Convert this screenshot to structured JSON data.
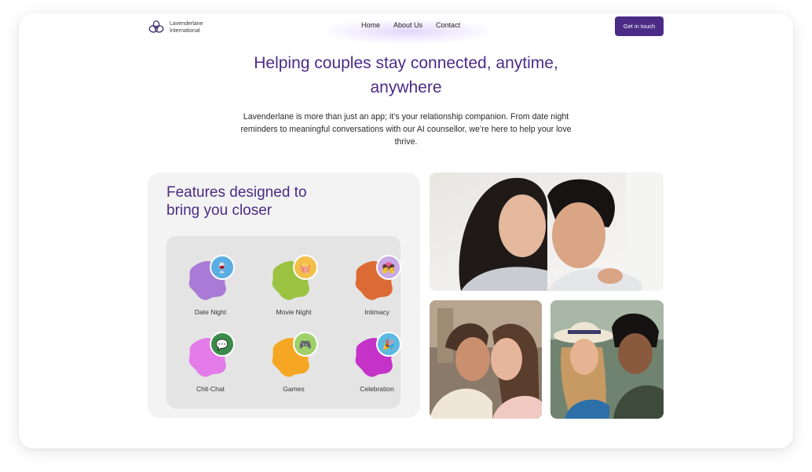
{
  "header": {
    "brand_line1": "Lavenderlane",
    "brand_line2": "International",
    "nav": [
      {
        "label": "Home"
      },
      {
        "label": "About Us"
      },
      {
        "label": "Contact"
      }
    ],
    "cta_label": "Get in touch"
  },
  "hero": {
    "title_line1": "Helping couples stay connected, anytime,",
    "title_line2": "anywhere",
    "subtitle": "Lavenderlane is more than just an app; it’s your relationship companion. From date night reminders to meaningful conversations with our AI counsellor, we’re here to help your love thrive."
  },
  "features": {
    "title_line1": "Features designed to",
    "title_line2": "bring you closer",
    "items": [
      {
        "label": "Date Night",
        "icon": "date-night-icon",
        "blob_color": "#a97bd6",
        "badge_color": "#5aaee3"
      },
      {
        "label": "Movie Night",
        "icon": "movie-night-icon",
        "blob_color": "#9bc241",
        "badge_color": "#f2c04a"
      },
      {
        "label": "Intimacy",
        "icon": "intimacy-icon",
        "blob_color": "#dc6a34",
        "badge_color": "#c9a8e6"
      },
      {
        "label": "Chit-Chat",
        "icon": "chit-chat-icon",
        "blob_color": "#e37be8",
        "badge_color": "#3b8a4b"
      },
      {
        "label": "Games",
        "icon": "games-icon",
        "blob_color": "#f5a724",
        "badge_color": "#9fd06a"
      },
      {
        "label": "Celebration",
        "icon": "celebration-icon",
        "blob_color": "#c432c8",
        "badge_color": "#5ab9e3"
      }
    ]
  },
  "colors": {
    "brand": "#4c2b86",
    "card_bg": "#f3f3f3",
    "grid_bg": "#e4e4e4"
  }
}
